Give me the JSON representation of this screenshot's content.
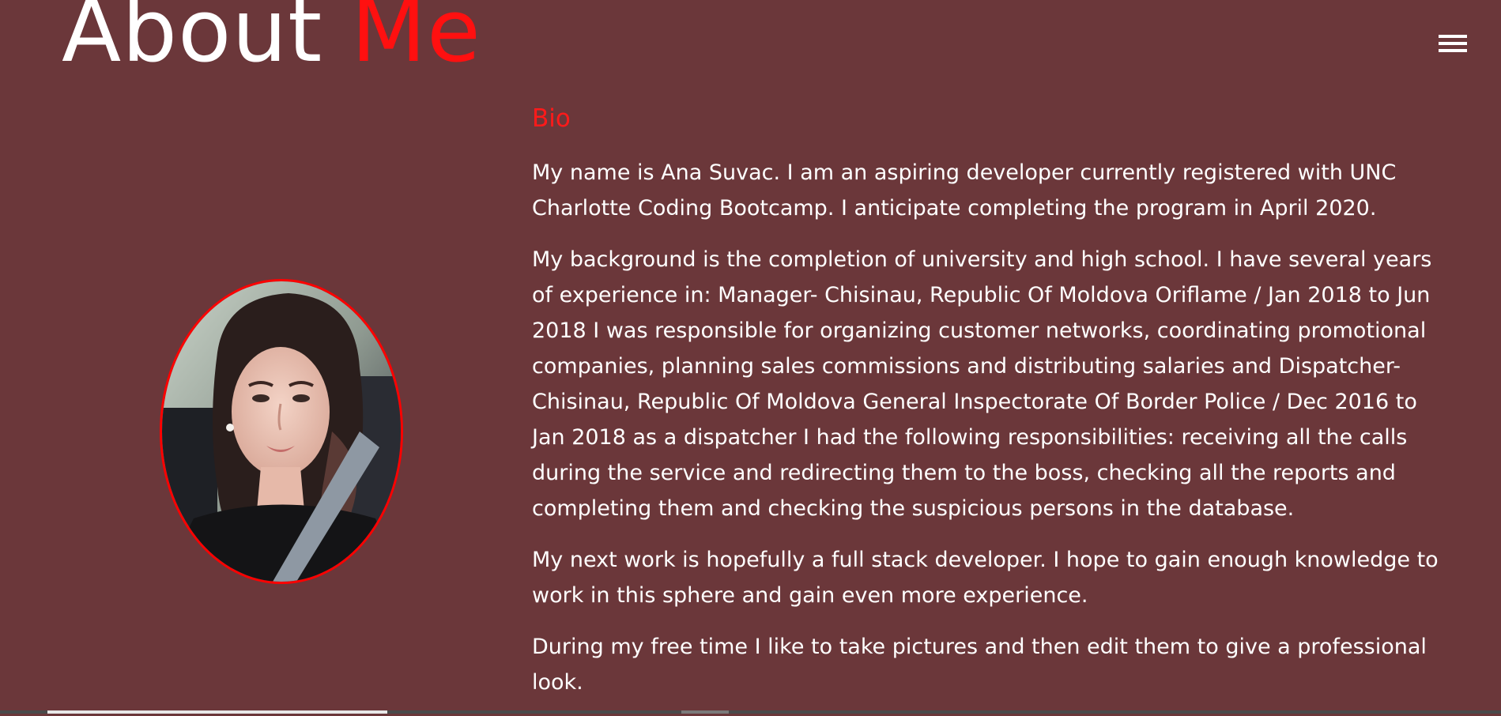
{
  "header": {
    "title_primary": "About",
    "title_accent": "Me",
    "accent_color": "#ff1010",
    "menu_icon": "hamburger-icon"
  },
  "profile": {
    "photo": "profile-photo",
    "border_color": "#ff0000"
  },
  "bio": {
    "heading": "Bio",
    "paragraphs": [
      "My name is Ana Suvac. I am an aspiring developer currently registered with UNC Charlotte Coding Bootcamp. I anticipate completing the program in April 2020.",
      "My background is the completion of university and high school. I have several years of experience in: Manager-  Chisinau, Republic Of Moldova Oriflame / Jan 2018 to Jun 2018  I was responsible for organizing customer networks, coordinating promotional companies, planning sales commissions and distributing salaries and Dispatcher-  Chisinau, Republic Of Moldova General Inspectorate Of Border Police / Dec 2016 to Jan 2018  as a dispatcher I had the following responsibilities: receiving all the calls during the service and redirecting them to the boss, checking all the reports and completing them and checking the suspicious persons in the database.",
      "My next work is hopefully a full stack developer. I hope to gain enough knowledge to work in this sphere and gain even more experience.",
      "During my free time I like to take pictures and then edit them to give a professional look."
    ]
  },
  "colors": {
    "background": "#6b373a",
    "text": "#ffffff",
    "heading_accent": "#ff1a1a"
  }
}
